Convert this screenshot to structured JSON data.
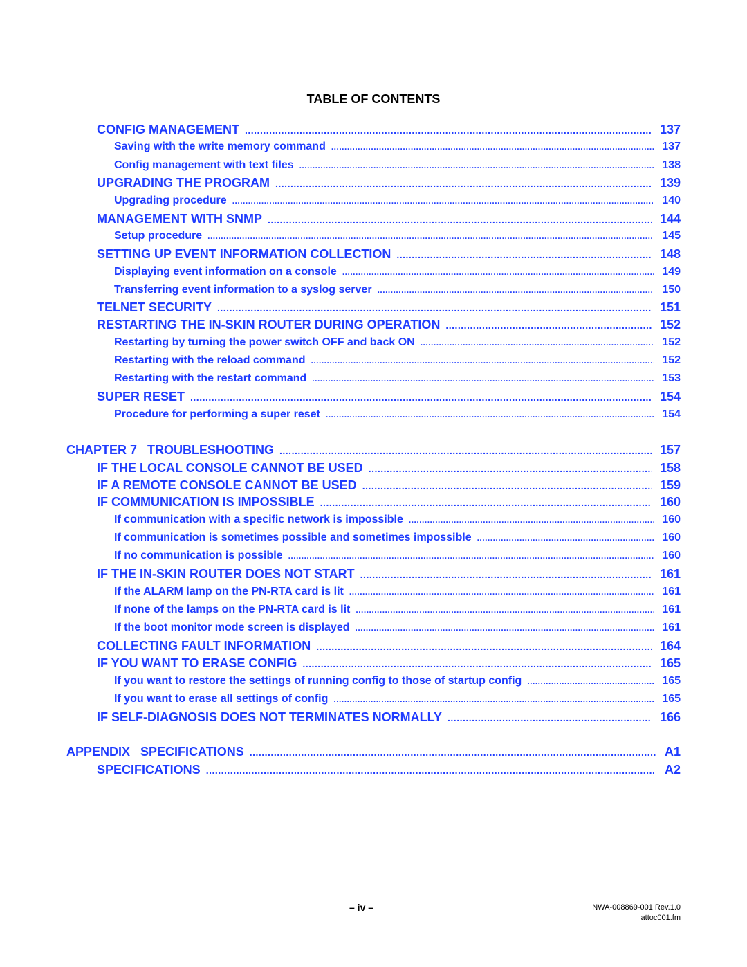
{
  "title": "TABLE OF CONTENTS",
  "entries": [
    {
      "label": "CONFIG MANAGEMENT",
      "page": "137",
      "level": 1
    },
    {
      "label": "Saving with the write memory command",
      "page": "137",
      "level": 2
    },
    {
      "label": "Config management with text files",
      "page": "138",
      "level": 2
    },
    {
      "label": "UPGRADING THE PROGRAM",
      "page": "139",
      "level": 1
    },
    {
      "label": "Upgrading procedure",
      "page": "140",
      "level": 2
    },
    {
      "label": "MANAGEMENT WITH SNMP",
      "page": "144",
      "level": 1
    },
    {
      "label": "Setup procedure",
      "page": "145",
      "level": 2
    },
    {
      "label": "SETTING UP EVENT INFORMATION COLLECTION",
      "page": "148",
      "level": 1
    },
    {
      "label": "Displaying event information on a console",
      "page": "149",
      "level": 2
    },
    {
      "label": "Transferring event information to a syslog server",
      "page": "150",
      "level": 2
    },
    {
      "label": "TELNET SECURITY",
      "page": "151",
      "level": 1
    },
    {
      "label": "RESTARTING THE IN-SKIN ROUTER DURING OPERATION",
      "page": "152",
      "level": 1
    },
    {
      "label": "Restarting by turning the power switch OFF and back ON",
      "page": "152",
      "level": 2
    },
    {
      "label": "Restarting with the reload command",
      "page": "152",
      "level": 2
    },
    {
      "label": "Restarting with the restart command",
      "page": "153",
      "level": 2
    },
    {
      "label": "SUPER RESET",
      "page": "154",
      "level": 1
    },
    {
      "label": "Procedure for performing a super reset",
      "page": "154",
      "level": 2
    },
    {
      "label": "CHAPTER 7   TROUBLESHOOTING",
      "page": "157",
      "level": 0
    },
    {
      "label": "IF THE LOCAL CONSOLE CANNOT BE USED",
      "page": "158",
      "level": 1
    },
    {
      "label": "IF A REMOTE CONSOLE CANNOT BE USED",
      "page": "159",
      "level": 1
    },
    {
      "label": "IF COMMUNICATION IS IMPOSSIBLE",
      "page": "160",
      "level": 1
    },
    {
      "label": "If communication with a specific network is impossible",
      "page": "160",
      "level": 2
    },
    {
      "label": "If communication is sometimes possible and sometimes impossible",
      "page": "160",
      "level": 2
    },
    {
      "label": "If no communication is possible",
      "page": "160",
      "level": 2
    },
    {
      "label": "IF THE IN-SKIN ROUTER DOES NOT START",
      "page": "161",
      "level": 1
    },
    {
      "label": "If the ALARM lamp on the PN-RTA card is lit",
      "page": "161",
      "level": 2
    },
    {
      "label": "If none of the lamps on the PN-RTA card is lit",
      "page": "161",
      "level": 2
    },
    {
      "label": "If the boot monitor mode screen is displayed",
      "page": "161",
      "level": 2
    },
    {
      "label": "COLLECTING FAULT INFORMATION",
      "page": "164",
      "level": 1
    },
    {
      "label": "IF YOU WANT TO ERASE CONFIG",
      "page": "165",
      "level": 1
    },
    {
      "label": "If you want to restore the settings of running config to those of startup config",
      "page": "165",
      "level": 2
    },
    {
      "label": "If you want to erase all settings of config",
      "page": "165",
      "level": 2
    },
    {
      "label": "IF SELF-DIAGNOSIS DOES NOT TERMINATES NORMALLY",
      "page": "166",
      "level": 1
    },
    {
      "label": "APPENDIX   SPECIFICATIONS",
      "page": "A1",
      "level": 0
    },
    {
      "label": "SPECIFICATIONS",
      "page": "A2",
      "level": 1
    }
  ],
  "footer": {
    "page_number": "– iv –",
    "doc_id": "NWA-008869-001 Rev.1.0",
    "file_name": "attoc001.fm"
  },
  "colors": {
    "link": "#1f3cff",
    "title": "#000000"
  }
}
